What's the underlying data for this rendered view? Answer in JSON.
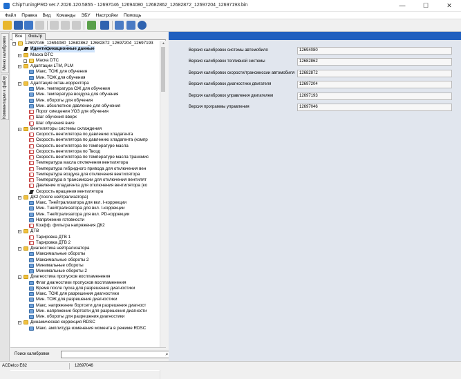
{
  "window": {
    "title": "ChipTuningPRO ver.7.2026.120.5855 - 12697046_12694080_12682862_12682872_12697204_12697193.bin",
    "minimize": "—",
    "maximize": "☐",
    "close": "✕"
  },
  "menu": [
    "Файл",
    "Правка",
    "Вид",
    "Команды",
    "ЭБУ",
    "Настройки",
    "Помощь"
  ],
  "side_tabs": [
    "Меню калибровок",
    "Комментарии к файлу"
  ],
  "tree_tabs": [
    "Все",
    "Фильтр"
  ],
  "tree": [
    {
      "level": 0,
      "type": "openfolder",
      "label": "12697046_12694080_12682862_12682872_12697204_12697193"
    },
    {
      "level": 1,
      "type": "flag",
      "label": "Идентификационные данные",
      "bold": true,
      "selected": true
    },
    {
      "level": 1,
      "type": "folder",
      "label": "Маска DTC"
    },
    {
      "level": 2,
      "type": "openfolder",
      "label": "Маска DTC"
    },
    {
      "level": 1,
      "type": "folder",
      "label": "Адаптации LTM, PLM"
    },
    {
      "level": 2,
      "type": "param",
      "label": "Макс. ТОЖ для обучения"
    },
    {
      "level": 2,
      "type": "param",
      "label": "Мин. ТОЖ для обучения"
    },
    {
      "level": 1,
      "type": "folder",
      "label": "Адаптация октан-корректора"
    },
    {
      "level": 2,
      "type": "param",
      "label": "Мин. температура ОЖ для обучения"
    },
    {
      "level": 2,
      "type": "param",
      "label": "Мин. температура воздуха для обучения"
    },
    {
      "level": 2,
      "type": "param",
      "label": "Мин. обороты для обучения"
    },
    {
      "level": 2,
      "type": "param",
      "label": "Мин. абсолютное давление для обучения"
    },
    {
      "level": 2,
      "type": "graph",
      "label": "Порог смещения УОЗ для обучения"
    },
    {
      "level": 2,
      "type": "graph",
      "label": "Шаг обучения вверх"
    },
    {
      "level": 2,
      "type": "graph",
      "label": "Шаг обучения вниз"
    },
    {
      "level": 1,
      "type": "folder",
      "label": "Вентиляторы системы охлаждения"
    },
    {
      "level": 2,
      "type": "graph",
      "label": "Скорость вентилятора по давлению хладагента"
    },
    {
      "level": 2,
      "type": "graph",
      "label": "Скорость вентилятора по давлению хладагента (компр"
    },
    {
      "level": 2,
      "type": "graph",
      "label": "Скорость вентилятора по температуре масла"
    },
    {
      "level": 2,
      "type": "graph",
      "label": "Скорость вентилятора по Твозд"
    },
    {
      "level": 2,
      "type": "graph",
      "label": "Скорость вентилятора по температуре масла трансмис"
    },
    {
      "level": 2,
      "type": "graph",
      "label": "Температура масла отключения вентилятора"
    },
    {
      "level": 2,
      "type": "graph",
      "label": "Температура гибридного привода для отключения вен"
    },
    {
      "level": 2,
      "type": "graph",
      "label": "Температура воздуха для отключения вентилятора"
    },
    {
      "level": 2,
      "type": "graph",
      "label": "Температура в трансмиссии для отключения вентилят"
    },
    {
      "level": 2,
      "type": "graph",
      "label": "Давление хладагента для отключения вентилятора (ко"
    },
    {
      "level": 2,
      "type": "flag",
      "label": "Скорость вращения вентилятора"
    },
    {
      "level": 1,
      "type": "folder",
      "label": "ДК2 (после нейтрализатора)"
    },
    {
      "level": 2,
      "type": "param",
      "label": "Макс. Тнейтрализатора для вкл. I-коррекции"
    },
    {
      "level": 2,
      "type": "param",
      "label": "Мин. Тнейтрализатора для вкл. I-коррекции"
    },
    {
      "level": 2,
      "type": "param",
      "label": "Мин. Тнейтрализатора для вкл. PD-коррекции"
    },
    {
      "level": 2,
      "type": "param",
      "label": "Напряжение готовности"
    },
    {
      "level": 2,
      "type": "graph",
      "label": "Коэфф. фильтра напряжения ДК2"
    },
    {
      "level": 1,
      "type": "folder",
      "label": "ДТВ"
    },
    {
      "level": 2,
      "type": "graph",
      "label": "Тарировка ДТВ 1"
    },
    {
      "level": 2,
      "type": "graph",
      "label": "Тарировка ДТВ 2"
    },
    {
      "level": 1,
      "type": "folder",
      "label": "Диагностика нейтрализатора"
    },
    {
      "level": 2,
      "type": "param",
      "label": "Максимальные обороты"
    },
    {
      "level": 2,
      "type": "param",
      "label": "Максимальные обороты 2"
    },
    {
      "level": 2,
      "type": "param",
      "label": "Минимальные обороты"
    },
    {
      "level": 2,
      "type": "param",
      "label": "Минимальные обороты 2"
    },
    {
      "level": 1,
      "type": "folder",
      "label": "Диагностика пропусков воспламенения"
    },
    {
      "level": 2,
      "type": "param",
      "label": "Флаг диагностики пропусков воспламенения"
    },
    {
      "level": 2,
      "type": "param",
      "label": "Время после пуска для разрешения диагностики"
    },
    {
      "level": 2,
      "type": "param",
      "label": "Макс. ТОЖ для разрешения диагностики"
    },
    {
      "level": 2,
      "type": "param",
      "label": "Мин. ТОЖ для разрешения диагностики"
    },
    {
      "level": 2,
      "type": "param",
      "label": "Макс. напряжение бортсети для разрешения диагност"
    },
    {
      "level": 2,
      "type": "param",
      "label": "Мин. напряжение бортсети для разрешения диагности"
    },
    {
      "level": 2,
      "type": "param",
      "label": "Мин. обороты для разрешения диагностики"
    },
    {
      "level": 1,
      "type": "folder",
      "label": "Динамическая коррекция RDSC"
    },
    {
      "level": 2,
      "type": "param",
      "label": "Макс. амплитуда изменения момента в режиме RDSC"
    }
  ],
  "search": {
    "label": "Поиск калибровки",
    "value": "",
    "placeholder": ""
  },
  "properties": [
    {
      "label": "Версия калибровок системы автомобиля",
      "value": "12694080"
    },
    {
      "label": "Версия калибровок топливной системы",
      "value": "12682862"
    },
    {
      "label": "Версия калибровок скорости/трансмиссии автомобиля",
      "value": "12682872"
    },
    {
      "label": "Версия калибровок диагностики двигателя",
      "value": "12697204"
    },
    {
      "label": "Версия калибровок управления двигателем",
      "value": "12697193"
    },
    {
      "label": "Версия программы управления",
      "value": "12697046"
    }
  ],
  "status": {
    "ecu": "ACDelco E82",
    "id": "12697046"
  },
  "colors": {
    "accent": "#1f5fbf",
    "panel_bg": "#e1e6ee"
  }
}
